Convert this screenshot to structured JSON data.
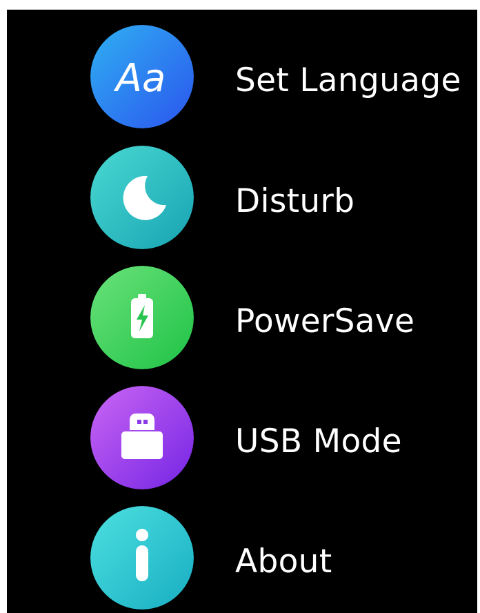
{
  "menu": {
    "items": [
      {
        "id": "set-language",
        "label": "Set Language",
        "icon": "language-aa-icon",
        "color_start": "#2fa6f0",
        "color_end": "#2d5ef0"
      },
      {
        "id": "disturb",
        "label": "Disturb",
        "icon": "moon-icon",
        "color_start": "#43d6d2",
        "color_end": "#1fa8b4"
      },
      {
        "id": "powersave",
        "label": "PowerSave",
        "icon": "battery-charging-icon",
        "color_start": "#5fe07a",
        "color_end": "#22c44a"
      },
      {
        "id": "usb-mode",
        "label": "USB Mode",
        "icon": "usb-plug-icon",
        "color_start": "#c45cf2",
        "color_end": "#7c2ee6"
      },
      {
        "id": "about",
        "label": "About",
        "icon": "info-icon",
        "color_start": "#45dde0",
        "color_end": "#1fb3c4"
      }
    ]
  }
}
